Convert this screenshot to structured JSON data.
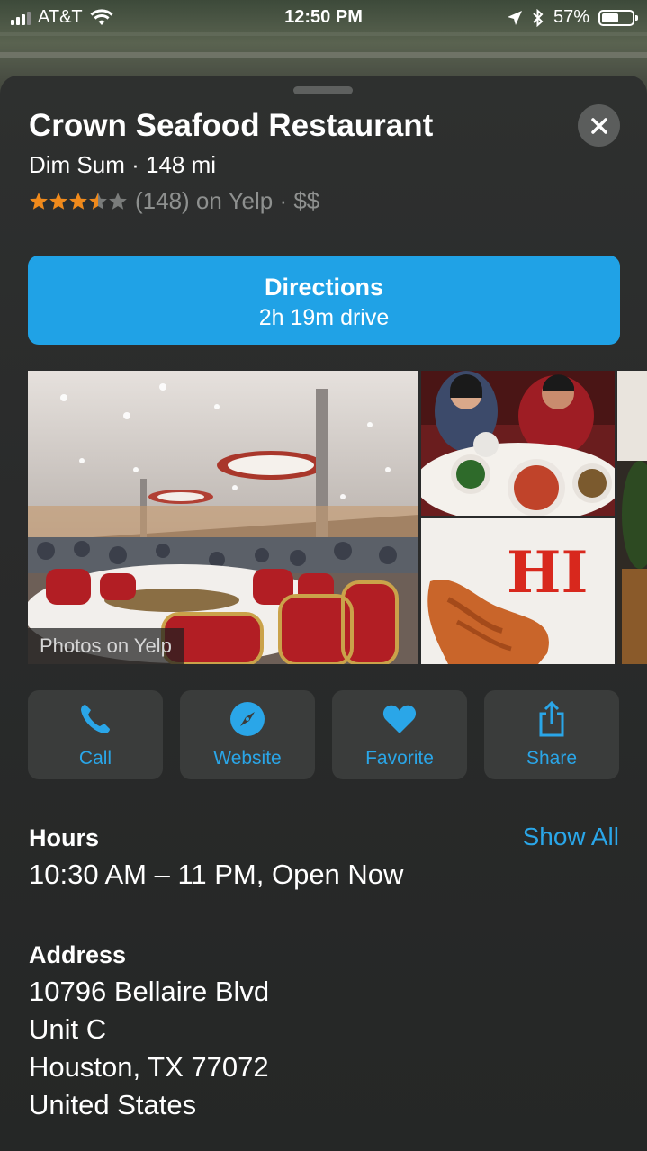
{
  "status_bar": {
    "carrier": "AT&T",
    "time": "12:50 PM",
    "battery_percent": "57%",
    "battery_level": 0.57
  },
  "place": {
    "name": "Crown Seafood Restaurant",
    "subtitle": "Dim Sum · 148 mi",
    "rating": {
      "stars": 3.5,
      "max_stars": 5,
      "text": "(148) on Yelp · $$"
    }
  },
  "directions": {
    "label": "Directions",
    "duration": "2h 19m drive"
  },
  "photos": {
    "label": "Photos on Yelp",
    "overlay_text": "HI"
  },
  "actions": [
    {
      "label": "Call",
      "icon": "phone-icon"
    },
    {
      "label": "Website",
      "icon": "compass-icon"
    },
    {
      "label": "Favorite",
      "icon": "heart-icon"
    },
    {
      "label": "Share",
      "icon": "share-icon"
    }
  ],
  "hours": {
    "title": "Hours",
    "value": "10:30 AM – 11 PM, Open Now",
    "show_all_label": "Show All"
  },
  "address": {
    "title": "Address",
    "lines": [
      "10796 Bellaire Blvd",
      "Unit C",
      "Houston, TX  77072",
      "United States"
    ]
  },
  "colors": {
    "accent": "#20a2e6",
    "link": "#2aa6e8",
    "star": "#f08a1c",
    "card_bg": "#2e302f",
    "button_bg": "#3a3c3b"
  }
}
